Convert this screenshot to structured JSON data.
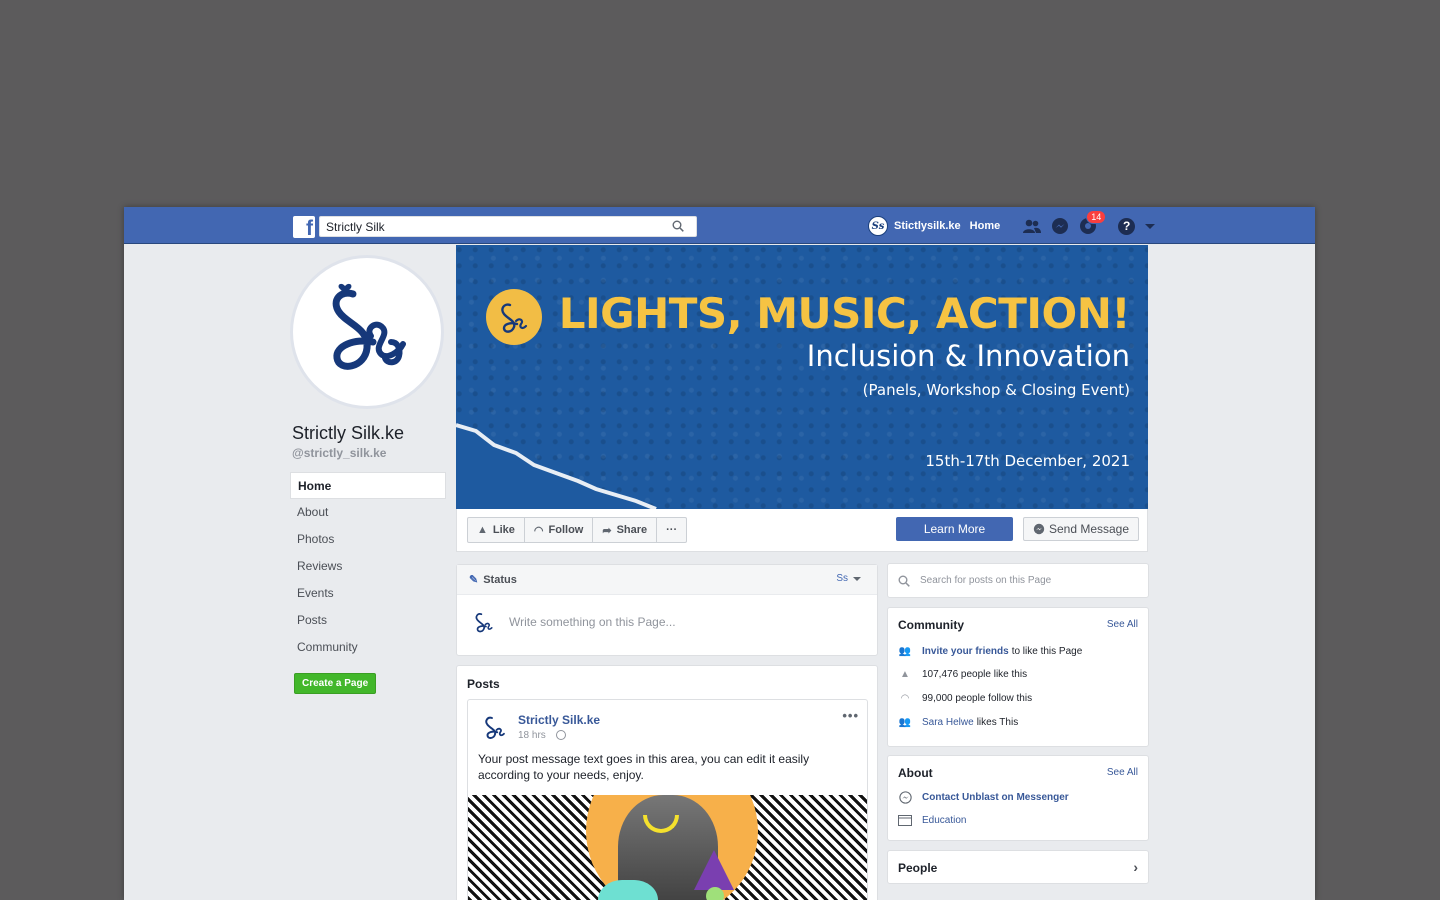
{
  "topbar": {
    "search_value": "Strictly Silk",
    "profile_name": "Stictlysilk.ke",
    "home_label": "Home",
    "notifications_count": "14"
  },
  "profile": {
    "logo_initials": "Ss",
    "name": "Strictly Silk.ke",
    "handle": "@strictly_silk.ke"
  },
  "leftnav": {
    "items": [
      {
        "label": "Home"
      },
      {
        "label": "About"
      },
      {
        "label": "Photos"
      },
      {
        "label": "Reviews"
      },
      {
        "label": "Events"
      },
      {
        "label": "Posts"
      },
      {
        "label": "Community"
      }
    ],
    "create_page_label": "Create a Page"
  },
  "cover": {
    "title": "LIGHTS, MUSIC, ACTION!",
    "subtitle": "Inclusion & Innovation",
    "details": "(Panels, Workshop & Closing Event)",
    "date": "15th-17th December, 2021"
  },
  "actions": {
    "like": "Like",
    "follow": "Follow",
    "share": "Share",
    "more": "···",
    "learn_more": "Learn More",
    "send_message": "Send Message"
  },
  "status": {
    "label": "Status",
    "placeholder": "Write something on this Page..."
  },
  "posts": {
    "title": "Posts",
    "author": "Strictly Silk.ke",
    "time": "18 hrs",
    "text": "Your post message text goes in this area, you can edit it easily according to your needs, enjoy."
  },
  "right": {
    "search_placeholder": "Search for posts on this Page",
    "community": {
      "title": "Community",
      "see_all": "See All",
      "invite_link": "Invite your friends",
      "invite_rest": "to like this Page",
      "likes": "107,476 people like this",
      "follows": "99,000 people follow this",
      "friend_name": "Sara Helwe",
      "friend_rest": "likes This"
    },
    "about": {
      "title": "About",
      "see_all": "See All",
      "messenger": "Contact Unblast on Messenger",
      "education": "Education"
    },
    "people": {
      "title": "People"
    }
  },
  "colors": {
    "facebook_blue": "#4267b2",
    "cover_blue": "#1e5aa0",
    "cover_yellow": "#f6c343",
    "create_green": "#42b72a"
  }
}
